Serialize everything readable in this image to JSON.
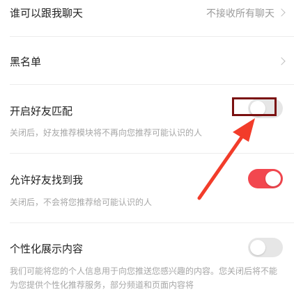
{
  "settings": {
    "who_can_chat": {
      "label": "谁可以跟我聊天",
      "value": "不接收所有聊天"
    },
    "blacklist": {
      "label": "黑名单"
    },
    "friend_match": {
      "label": "开启好友匹配",
      "desc": "关闭后，好友推荐模块将不再向您推荐可能认识的人",
      "enabled": false
    },
    "allow_find_me": {
      "label": "允许好友找到我",
      "desc": "关闭后，不会将您推荐给可能认识的人",
      "enabled": true
    },
    "personalized": {
      "label": "个性化展示内容",
      "desc": "我们可能将您的个人信息用于向您推送您感兴趣的内容。您关闭后将不能为您提供个性化推荐服务，部分频道和页面内容将",
      "enabled": false
    }
  },
  "colors": {
    "accent": "#f2474f",
    "annotation": "#7a1010",
    "arrow": "#f23c2a"
  }
}
